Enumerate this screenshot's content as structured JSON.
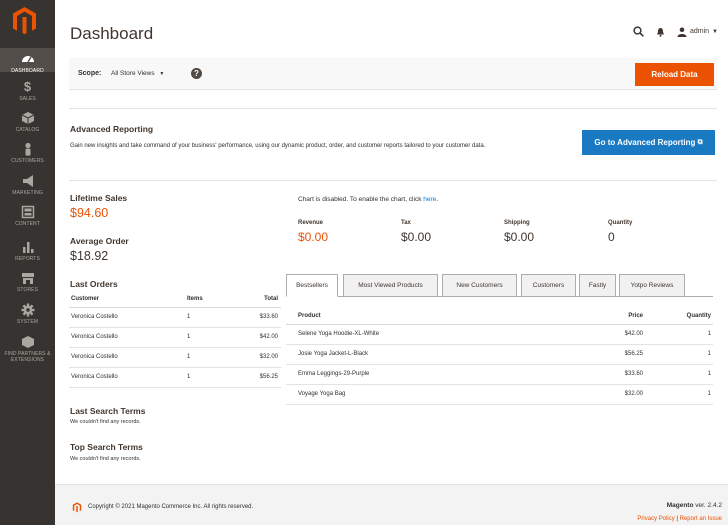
{
  "sidebar": {
    "items": [
      {
        "label": "DASHBOARD",
        "icon": "dashboard-icon"
      },
      {
        "label": "SALES",
        "icon": "dollar-icon"
      },
      {
        "label": "CATALOG",
        "icon": "box-icon"
      },
      {
        "label": "CUSTOMERS",
        "icon": "person-icon"
      },
      {
        "label": "MARKETING",
        "icon": "megaphone-icon"
      },
      {
        "label": "CONTENT",
        "icon": "layout-icon"
      },
      {
        "label": "REPORTS",
        "icon": "bar-chart-icon"
      },
      {
        "label": "STORES",
        "icon": "store-icon"
      },
      {
        "label": "SYSTEM",
        "icon": "gear-icon"
      },
      {
        "label": "FIND PARTNERS & EXTENSIONS",
        "icon": "cube-icon"
      }
    ]
  },
  "header": {
    "title": "Dashboard",
    "user": "admin"
  },
  "scope": {
    "label": "Scope:",
    "value": "All Store Views",
    "reload_label": "Reload Data"
  },
  "advanced": {
    "title": "Advanced Reporting",
    "description": "Gain new insights and take command of your business' performance, using our dynamic product, order, and customer reports tailored to your customer data.",
    "button_label": "Go to Advanced Reporting"
  },
  "lifetime_sales": {
    "label": "Lifetime Sales",
    "value": "$94.60"
  },
  "average_order": {
    "label": "Average Order",
    "value": "$18.92"
  },
  "chart_note": {
    "text": "Chart is disabled. To enable the chart, click ",
    "link": "here",
    "suffix": "."
  },
  "totals": [
    {
      "label": "Revenue",
      "value": "$0.00"
    },
    {
      "label": "Tax",
      "value": "$0.00"
    },
    {
      "label": "Shipping",
      "value": "$0.00"
    },
    {
      "label": "Quantity",
      "value": "0"
    }
  ],
  "last_orders": {
    "title": "Last Orders",
    "columns": [
      "Customer",
      "Items",
      "Total"
    ],
    "rows": [
      [
        "Veronica Costello",
        "1",
        "$33.60"
      ],
      [
        "Veronica Costello",
        "1",
        "$42.00"
      ],
      [
        "Veronica Costello",
        "1",
        "$32.00"
      ],
      [
        "Veronica Costello",
        "1",
        "$56.25"
      ]
    ]
  },
  "tabs": [
    "Bestsellers",
    "Most Viewed Products",
    "New Customers",
    "Customers",
    "Fastly",
    "Yotpo Reviews"
  ],
  "bestsellers": {
    "columns": [
      "Product",
      "Price",
      "Quantity"
    ],
    "rows": [
      [
        "Selene Yoga Hoodie-XL-White",
        "$42.00",
        "1"
      ],
      [
        "Josie Yoga Jacket-L-Black",
        "$56.25",
        "1"
      ],
      [
        "Emma Leggings-29-Purple",
        "$33.60",
        "1"
      ],
      [
        "Voyage Yoga Bag",
        "$32.00",
        "1"
      ]
    ]
  },
  "last_search": {
    "title": "Last Search Terms",
    "note": "We couldn't find any records."
  },
  "top_search": {
    "title": "Top Search Terms",
    "note": "We couldn't find any records."
  },
  "footer": {
    "copyright": "Copyright © 2021 Magento Commerce Inc. All rights reserved.",
    "brand": "Magento",
    "version": " ver. 2.4.2",
    "privacy": "Privacy Policy",
    "separator": " | ",
    "report": "Report an Issue"
  },
  "colors": {
    "accent": "#eb5202",
    "link": "#007bdb",
    "button_blue": "#1979c3",
    "sidebar": "#373330",
    "sales": "#eb5202"
  }
}
